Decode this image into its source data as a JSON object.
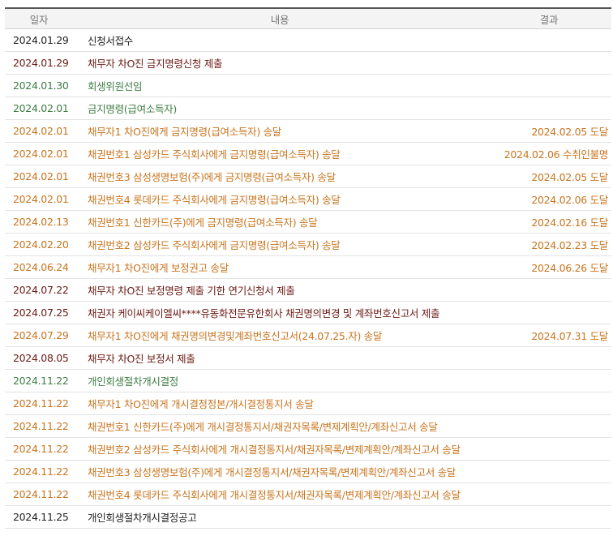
{
  "colors": {
    "maroon": "#6b1a14",
    "green": "#3e7d44",
    "orange": "#c8741e",
    "black": "#222222"
  },
  "header": {
    "date_label": "일자",
    "content_label": "내용",
    "result_label": "결과"
  },
  "rows": [
    {
      "date": "2024.01.29",
      "content": "신청서접수",
      "result": "",
      "color": "black"
    },
    {
      "date": "2024.01.29",
      "content": "채무자 차O진 금지명령신청 제출",
      "result": "",
      "color": "maroon"
    },
    {
      "date": "2024.01.30",
      "content": "회생위원선임",
      "result": "",
      "color": "green"
    },
    {
      "date": "2024.02.01",
      "content": "금지명령(급여소득자)",
      "result": "",
      "color": "green"
    },
    {
      "date": "2024.02.01",
      "content": "채무자1 차O진에게 금지명령(급여소득자) 송달",
      "result": "2024.02.05 도달",
      "color": "orange"
    },
    {
      "date": "2024.02.01",
      "content": "채권번호1 삼성카드 주식회사에게 금지명령(급여소득자) 송달",
      "result": "2024.02.06 수취인불명",
      "color": "orange"
    },
    {
      "date": "2024.02.01",
      "content": "채권번호3 삼성생명보험(주)에게 금지명령(급여소득자) 송달",
      "result": "2024.02.05 도달",
      "color": "orange"
    },
    {
      "date": "2024.02.01",
      "content": "채권번호4 롯데카드 주식회사에게 금지명령(급여소득자) 송달",
      "result": "2024.02.06 도달",
      "color": "orange"
    },
    {
      "date": "2024.02.13",
      "content": "채권번호1 신한카드(주)에게 금지명령(급여소득자) 송달",
      "result": "2024.02.16 도달",
      "color": "orange"
    },
    {
      "date": "2024.02.20",
      "content": "채권번호2 삼성카드 주식회사에게 금지명령(급여소득자) 송달",
      "result": "2024.02.23 도달",
      "color": "orange"
    },
    {
      "date": "2024.06.24",
      "content": "채무자1 차O진에게 보정권고 송달",
      "result": "2024.06.26 도달",
      "color": "orange"
    },
    {
      "date": "2024.07.22",
      "content": "채무자 차O진 보정명령 제출 기한 연기신청서 제출",
      "result": "",
      "color": "maroon"
    },
    {
      "date": "2024.07.25",
      "content": "채권자 케이씨케이엘씨****유동화전문유한회사 채권명의변경 및 계좌번호신고서 제출",
      "result": "",
      "color": "maroon"
    },
    {
      "date": "2024.07.29",
      "content": "채무자1 차O진에게 채권명의변경및계좌번호신고서(24.07.25.자) 송달",
      "result": "2024.07.31 도달",
      "color": "orange"
    },
    {
      "date": "2024.08.05",
      "content": "채무자 차O진 보정서 제출",
      "result": "",
      "color": "maroon"
    },
    {
      "date": "2024.11.22",
      "content": "개인회생절차개시결정",
      "result": "",
      "color": "green"
    },
    {
      "date": "2024.11.22",
      "content": "채무자1 차O진에게 개시결정정본/개시결정통지서 송달",
      "result": "",
      "color": "orange"
    },
    {
      "date": "2024.11.22",
      "content": "채권번호1 신한카드(주)에게 개시결정통지서/채권자목록/변제계획안/계좌신고서 송달",
      "result": "",
      "color": "orange"
    },
    {
      "date": "2024.11.22",
      "content": "채권번호2 삼성카드 주식회사에게 개시결정통지서/채권자목록/변제계획안/계좌신고서 송달",
      "result": "",
      "color": "orange"
    },
    {
      "date": "2024.11.22",
      "content": "채권번호3 삼성생명보험(주)에게 개시결정통지서/채권자목록/변제계획안/계좌신고서 송달",
      "result": "",
      "color": "orange"
    },
    {
      "date": "2024.11.22",
      "content": "채권번호4 롯데카드 주식회사에게 개시결정통지서/채권자목록/변제계획안/계좌신고서 송달",
      "result": "",
      "color": "orange"
    },
    {
      "date": "2024.11.25",
      "content": "개인회생절차개시결정공고",
      "result": "",
      "color": "black"
    }
  ]
}
